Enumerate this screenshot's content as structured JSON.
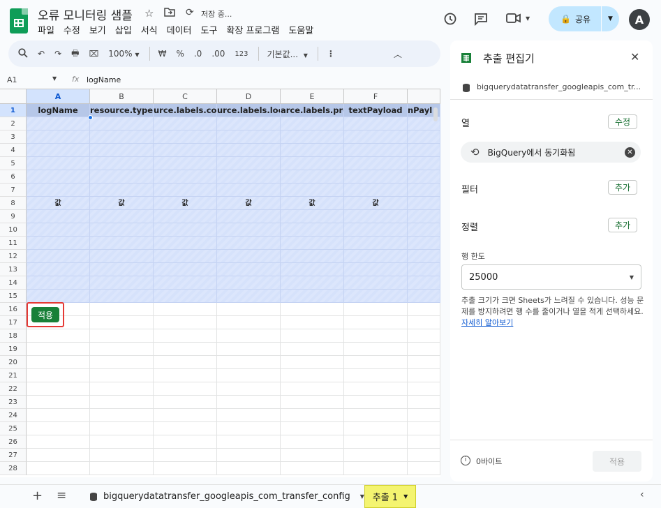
{
  "doc": {
    "title": "오류 모니터링 샘플",
    "save_status": "저장 중..."
  },
  "menu": [
    "파일",
    "수정",
    "보기",
    "삽입",
    "서식",
    "데이터",
    "도구",
    "확장 프로그램",
    "도움말"
  ],
  "share": {
    "label": "공유"
  },
  "avatar": "A",
  "toolbar": {
    "zoom": "100%",
    "currency": "₩",
    "percent": "%",
    "dec_less": ".0",
    "dec_more": ".00",
    "format_more": "123",
    "font": "기본값..."
  },
  "formula": {
    "cell_ref": "A1",
    "fx": "fx",
    "value": "logName"
  },
  "grid": {
    "columns": [
      "A",
      "B",
      "C",
      "D",
      "E",
      "F",
      ""
    ],
    "headers": [
      "logName",
      "resource.type",
      "urce.labels.conf",
      "urce.labels.loca",
      "arce.labels.proje",
      "textPayload",
      "nPayl"
    ],
    "value_label": "값",
    "rows": [
      "1",
      "2",
      "3",
      "4",
      "5",
      "6",
      "7",
      "8",
      "9",
      "10",
      "11",
      "12",
      "13",
      "14",
      "15",
      "16",
      "17",
      "18",
      "19",
      "20",
      "21",
      "22",
      "23",
      "24",
      "25",
      "26",
      "27",
      "28"
    ]
  },
  "apply_chip": "적용",
  "panel": {
    "title": "추출 편집기",
    "source": "bigquerydatatransfer_googleapis_com_tr...",
    "columns_label": "열",
    "columns_edit": "수정",
    "sync_chip": "BigQuery에서 동기화됨",
    "filter_label": "필터",
    "filter_add": "추가",
    "sort_label": "정렬",
    "sort_add": "추가",
    "rowlimit_label": "행 한도",
    "rowlimit_value": "25000",
    "warning": "추출 크기가 크면 Sheets가 느려질 수 있습니다. 성능 문제를 방지하려면 행 수를 줄이거나 열을 적게 선택하세요.",
    "learn_more": "자세히 알아보기",
    "size": "0바이트",
    "apply": "적용"
  },
  "bottom": {
    "sheet_tab": "bigquerydatatransfer_googleapis_com_transfer_config",
    "extract_tab": "추출 1"
  },
  "colors": {
    "accent_green": "#188038",
    "table_header": "#b6c7e8",
    "highlight_tab": "#f4f470",
    "share_bg": "#c2e7ff"
  }
}
